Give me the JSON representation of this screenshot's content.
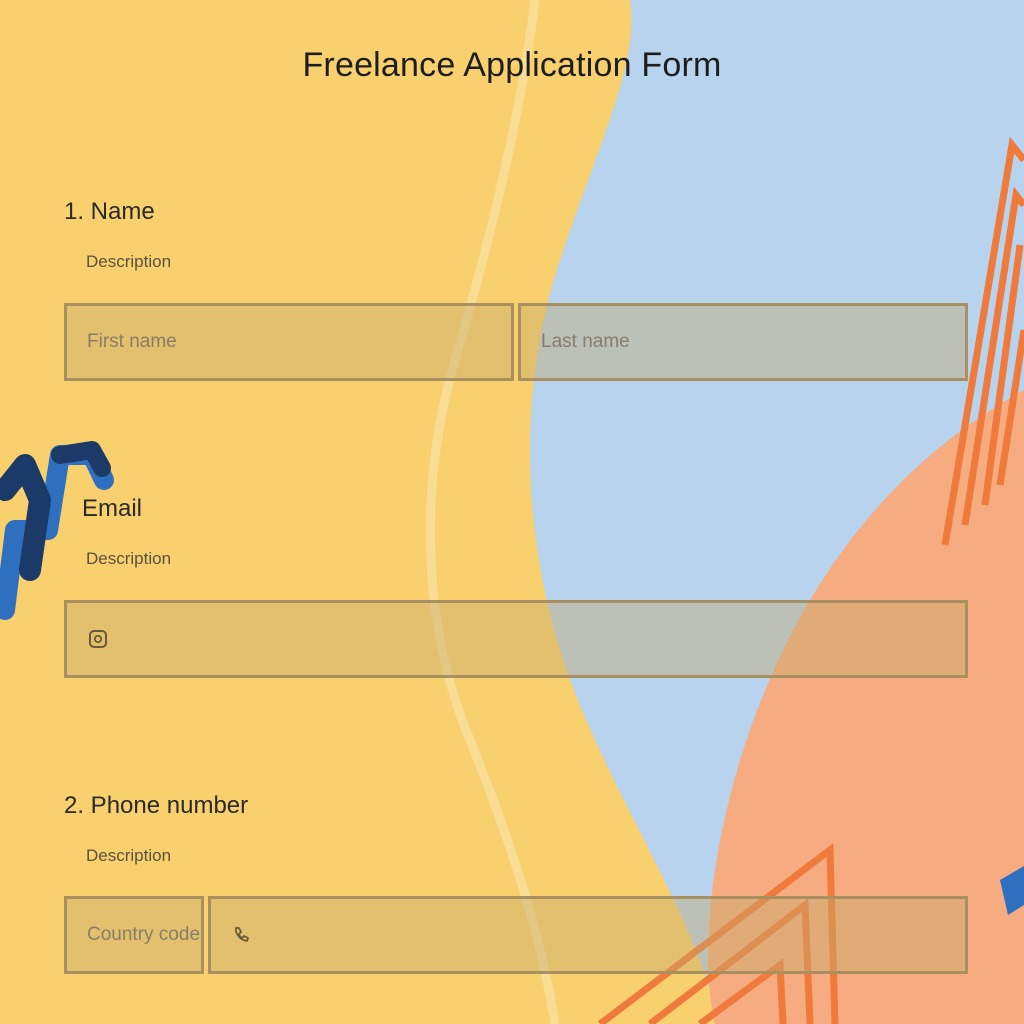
{
  "form": {
    "title": "Freelance Application Form"
  },
  "questions": [
    {
      "label": "1. Name",
      "description": "Description",
      "fields": [
        {
          "placeholder": "First name"
        },
        {
          "placeholder": "Last name"
        }
      ]
    },
    {
      "label": "Email",
      "description": "Description",
      "fields": [
        {
          "placeholder": "",
          "icon": "email-icon"
        }
      ]
    },
    {
      "label": "2. Phone number",
      "description": "Description",
      "fields": [
        {
          "placeholder": "Country code"
        },
        {
          "placeholder": "",
          "icon": "phone-icon"
        }
      ]
    }
  ],
  "colors": {
    "yellow": "#f9d06e",
    "blue": "#b7d3ee",
    "peach": "#f6ac80",
    "orange_stripe": "#ef7a3c",
    "navy_squiggle": "#1b3a68",
    "mid_blue_squiggle": "#2f6fc0"
  }
}
